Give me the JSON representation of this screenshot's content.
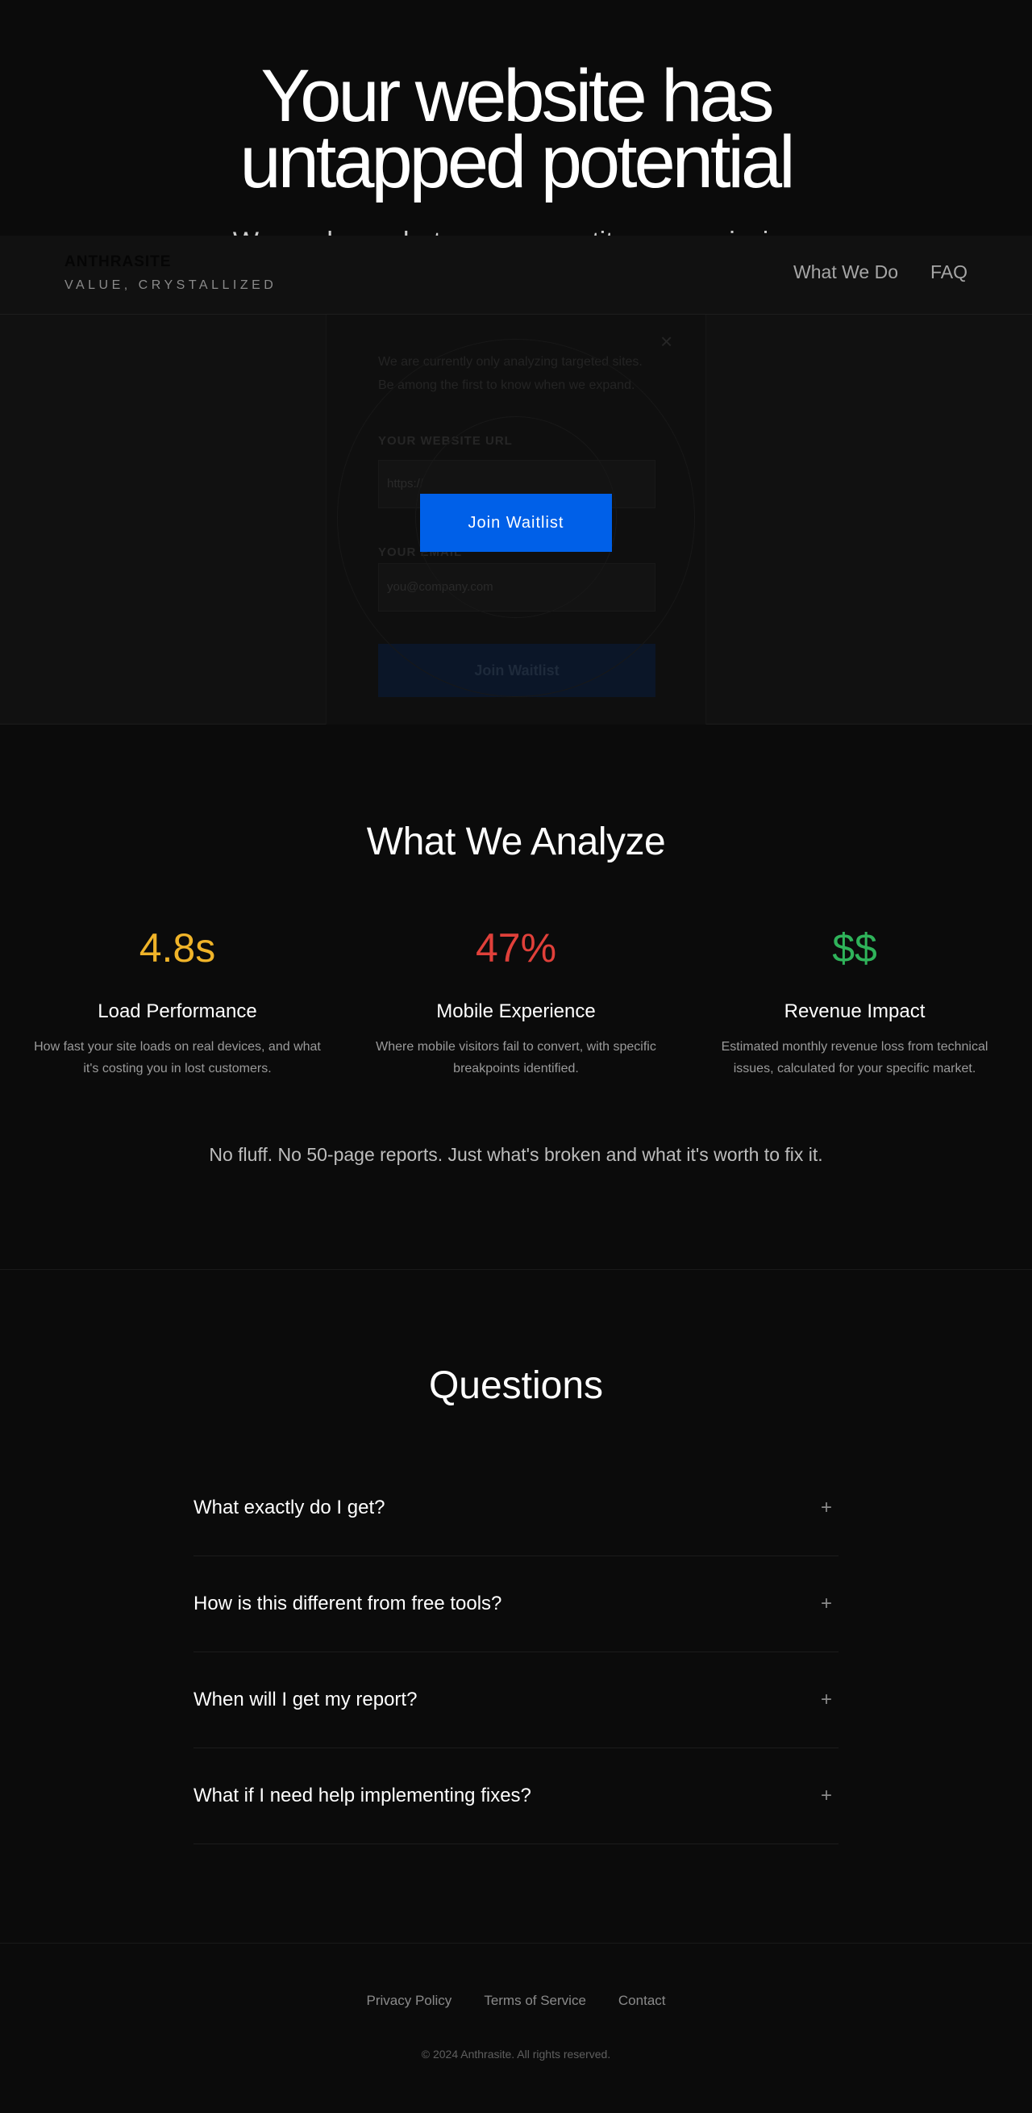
{
  "hero": {
    "title_line1": "Your website has",
    "title_line2": "untapped potential",
    "subtitle_clipped": "We analyze what your competitors are missing"
  },
  "header": {
    "brand_name": "ANTHRASITE",
    "brand_tagline": "VALUE, CRYSTALLIZED",
    "nav": [
      "What We Do",
      "FAQ"
    ]
  },
  "waitlist_modal": {
    "close_glyph": "×",
    "intro": "We are currently only analyzing targeted sites. Be among the first to know when we expand.",
    "url_label": "YOUR WEBSITE URL",
    "url_placeholder": "https://",
    "email_label": "YOUR EMAIL",
    "email_placeholder": "you@company.com",
    "submit_label": "Join Waitlist"
  },
  "cta": {
    "label": "Join Waitlist",
    "color": "#0060e8"
  },
  "analyze": {
    "title": "What We Analyze",
    "metrics": [
      {
        "value": "4.8s",
        "heading": "Load Performance",
        "description": "How fast your site loads on real devices, and what it's costing you in lost customers.",
        "color": "#f0b429"
      },
      {
        "value": "47%",
        "heading": "Mobile Experience",
        "description": "Where mobile visitors fail to convert, with specific breakpoints identified.",
        "color": "#e0403a"
      },
      {
        "value": "$$",
        "heading": "Revenue Impact",
        "description": "Estimated monthly revenue loss from technical issues, calculated for your specific market.",
        "color": "#2fb35a"
      }
    ],
    "tagline": "No fluff. No 50-page reports. Just what's broken and what it's worth to fix it."
  },
  "faq": {
    "title": "Questions",
    "expand_glyph": "+",
    "items": [
      "What exactly do I get?",
      "How is this different from free tools?",
      "When will I get my report?",
      "What if I need help implementing fixes?"
    ]
  },
  "footer": {
    "links": [
      "Privacy Policy",
      "Terms of Service",
      "Contact"
    ],
    "copyright": "© 2024 Anthrasite. All rights reserved."
  }
}
